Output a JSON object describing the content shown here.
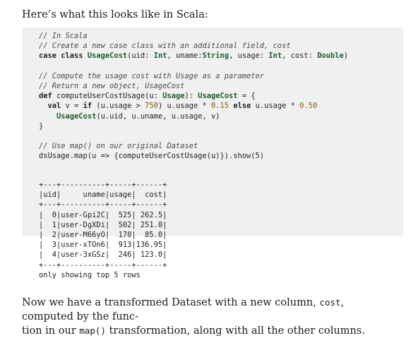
{
  "intro_text": "Here’s what this looks like in Scala:",
  "code": {
    "line1": "// In Scala",
    "line2": "// Create a new case class with an additional field, cost",
    "line3_kw": "case class",
    "line3_type": "UsageCost",
    "line3_rest_a": "(uid: ",
    "line3_int1": "Int",
    "line3_rest_b": ", uname:",
    "line3_str": "String",
    "line3_rest_c": ", usage: ",
    "line3_int2": "Int",
    "line3_rest_d": ", cost: ",
    "line3_dbl": "Double",
    "line3_end": ")",
    "line5": "// Compute the usage cost with Usage as a parameter",
    "line6": "// Return a new object, UsageCost",
    "line7_kw": "def",
    "line7_a": " computeUserCostUsage(u: ",
    "line7_t1": "Usage",
    "line7_b": "): ",
    "line7_t2": "UsageCost",
    "line7_c": " = {",
    "line8_indent": "  ",
    "line8_kw1": "val",
    "line8_a": " v = ",
    "line8_kw2": "if",
    "line8_b": " (u.usage > ",
    "line8_n1": "750",
    "line8_c": ") u.usage * ",
    "line8_n2": "0.15",
    "line8_kw3": " else",
    "line8_d": " u.usage * ",
    "line8_n3": "0.50",
    "line9_indent": "    ",
    "line9_t": "UsageCost",
    "line9_a": "(u.uid, u.uname, u.usage, v)",
    "line10": "}",
    "line12": "// Use map() on our original Dataset",
    "line13": "dsUsage.map(u => {computeUserCostUsage(u)}).show(5)"
  },
  "output": {
    "border": "+---+----------+-----+------+",
    "header": "|uid|     uname|usage|  cost|",
    "rows": [
      "|  0|user-Gpi2C|  525| 262.5|",
      "|  1|user-DgXDi|  502| 251.0|",
      "|  2|user-M66yO|  170|  85.0|",
      "|  3|user-xTOn6|  913|136.95|",
      "|  4|user-3xGSz|  246| 123.0|"
    ],
    "footer": "only showing top 5 rows"
  },
  "outro": {
    "a": "Now we have a transformed Dataset with a new column, ",
    "code1": "cost",
    "b": ", computed by the func-",
    "c": "tion in our ",
    "code2": "map()",
    "d": " transformation, along with all the other columns."
  }
}
